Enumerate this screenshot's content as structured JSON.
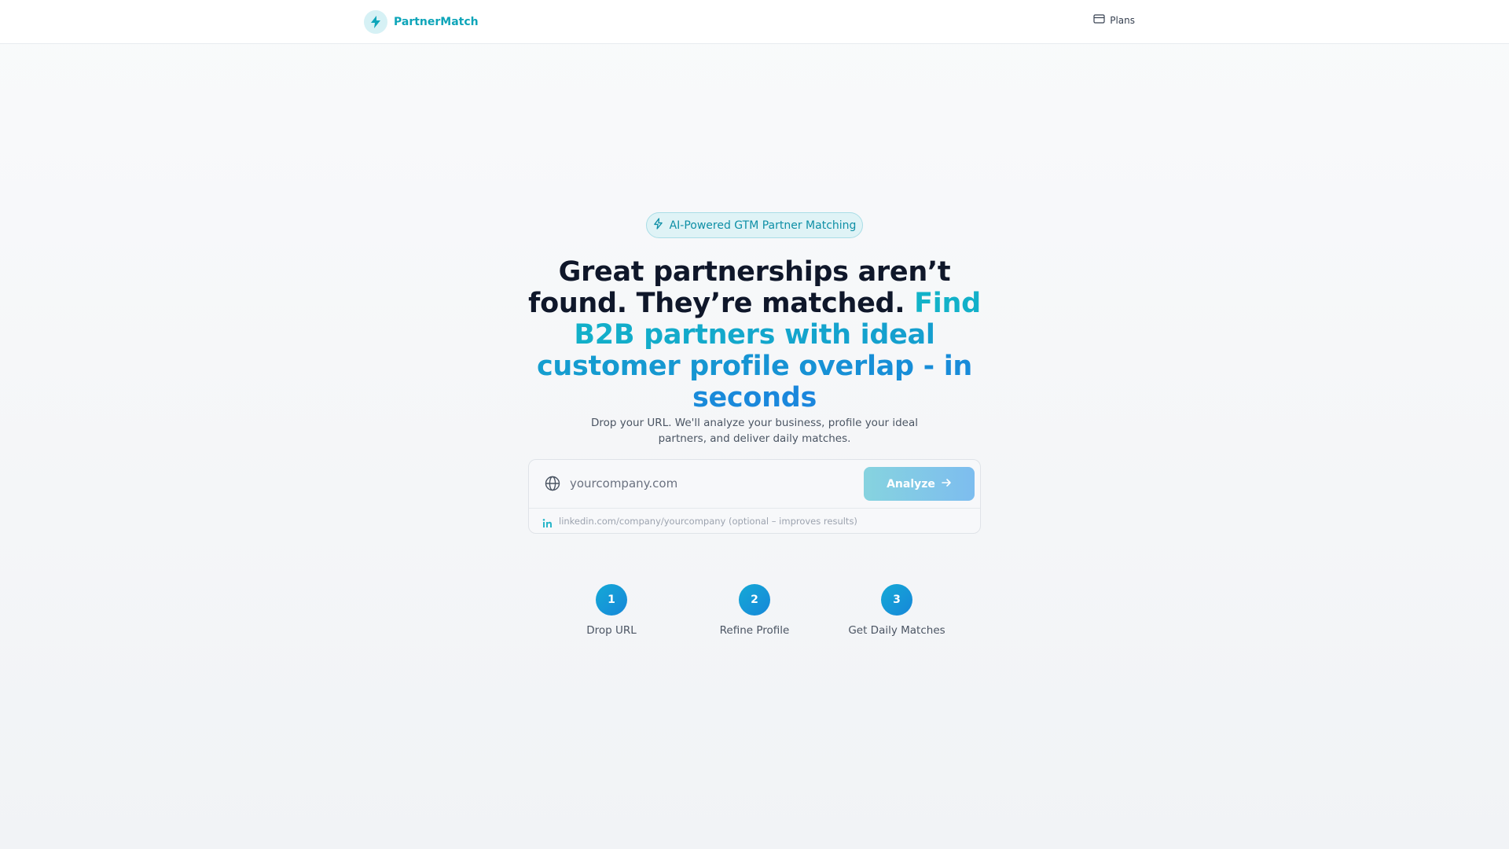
{
  "header": {
    "brand_name": "PartnerMatch",
    "brand_icon": "lightning-bolt-icon",
    "plans_label": "Plans",
    "plans_icon": "credit-card-icon"
  },
  "hero": {
    "badge_text": "AI-Powered GTM Partner Matching",
    "badge_icon": "lightning-bolt-icon",
    "headline_plain": "Great partnerships aren’t found. They’re matched.",
    "headline_accent": "Find B2B partners with ideal customer profile overlap - in seconds",
    "subtitle": "Drop your URL. We'll analyze your business, profile your ideal partners, and deliver daily matches."
  },
  "form": {
    "url_placeholder": "yourcompany.com",
    "url_value": "",
    "url_icon": "globe-icon",
    "analyze_label": "Analyze",
    "analyze_icon": "arrow-right-icon",
    "linkedin_placeholder": "linkedin.com/company/yourcompany (optional – improves results)",
    "linkedin_value": "",
    "linkedin_icon": "linkedin-icon"
  },
  "steps": [
    {
      "number": "1",
      "label": "Drop URL"
    },
    {
      "number": "2",
      "label": "Refine Profile"
    },
    {
      "number": "3",
      "label": "Get Daily Matches"
    }
  ],
  "colors": {
    "brand": "#0ea5b9",
    "accent_start": "#12b3c8",
    "accent_end": "#1a86dd",
    "step_circle": "#1787d9",
    "button_gradient_start": "#86d3df",
    "button_gradient_end": "#7dbdef"
  }
}
